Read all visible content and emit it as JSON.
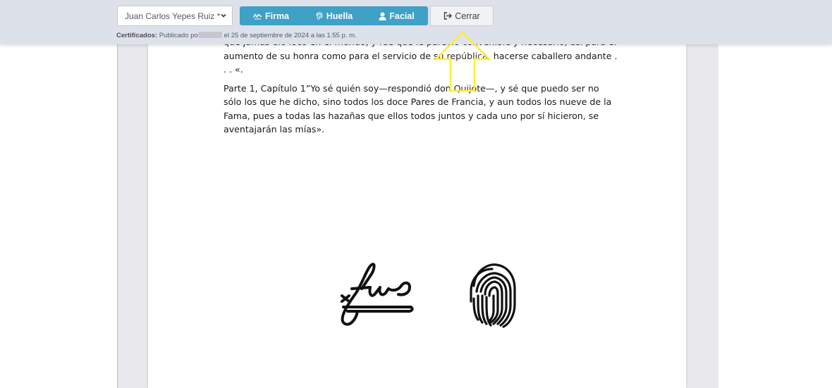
{
  "toolbar": {
    "signer_select": "Juan Carlos Yepes Ruiz *",
    "buttons": {
      "firma": "Firma",
      "huella": "Huella",
      "facial": "Facial",
      "cerrar": "Cerrar"
    },
    "certificates_label": "Certificados:",
    "published_prefix": "Publicado po",
    "published_suffix": "el 25 de septiembre de 2024 a las 1:55 p. m."
  },
  "document": {
    "paragraph_1": "que jamás dio loco en el mundo, y fue que le pareció convenible y necesario, así para el aumento de su honra como para el servicio de su república, hacerse caballero andante . . . «.",
    "paragraph_2": "Parte 1, Capítulo 1”Yo sé quién soy—respondió don Quijote—, y sé que puedo ser no sólo los que he dicho, sino todos los doce Pares de Francia, y aun todos los nueve de la Fama, pues a todas las hazañas que ellos todos juntos y cada uno por sí hicieron, se aventajarán las mías»."
  },
  "colors": {
    "accent": "#3fa1c6",
    "highlight_arrow": "#ffee33",
    "toolbar_bg": "#dde1ea"
  }
}
